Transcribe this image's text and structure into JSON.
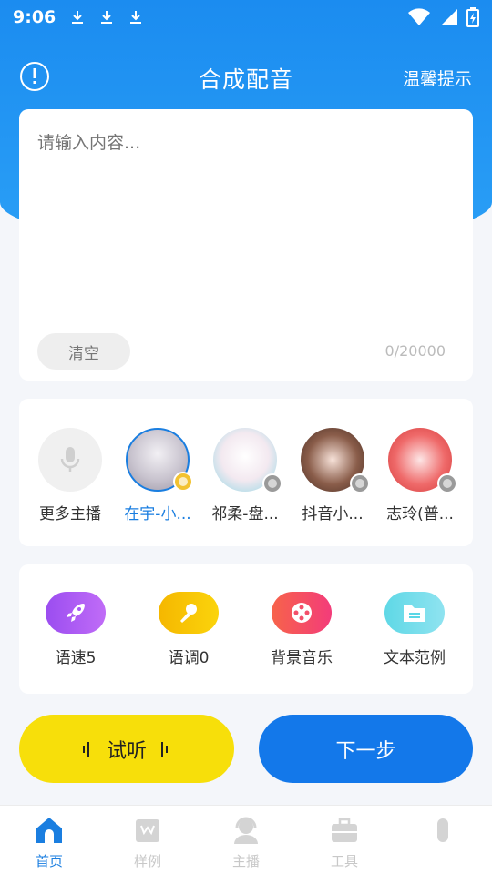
{
  "status_bar": {
    "time": "9:06"
  },
  "header": {
    "title": "合成配音",
    "tips_label": "温馨提示"
  },
  "input": {
    "placeholder": "请输入内容...",
    "clear_label": "清空",
    "char_count": "0/20000"
  },
  "voices": [
    {
      "label": "更多主播"
    },
    {
      "label": "在宇-小...",
      "badge": ""
    },
    {
      "label": "祁柔-盘...",
      "badge": ""
    },
    {
      "label": "抖音小...",
      "badge": ""
    },
    {
      "label": "志玲(普...",
      "badge": ""
    }
  ],
  "tools": [
    {
      "label": "语速5",
      "icon": "rocket-icon",
      "color": "#a855f7"
    },
    {
      "label": "语调0",
      "icon": "microphone-icon",
      "color": "#f5c400"
    },
    {
      "label": "背景音乐",
      "icon": "film-reel-icon",
      "color": "#f43f5e"
    },
    {
      "label": "文本范例",
      "icon": "folder-icon",
      "color": "#5ad7e6"
    }
  ],
  "actions": {
    "listen_label": "试听",
    "next_label": "下一步"
  },
  "nav": [
    {
      "label": "首页",
      "active": true
    },
    {
      "label": "样例"
    },
    {
      "label": "主播"
    },
    {
      "label": "工具"
    },
    {
      "label": ""
    }
  ],
  "colors": {
    "primary": "#1a7ee0",
    "accent_yellow": "#f7df0a",
    "next_blue": "#1378ea"
  }
}
